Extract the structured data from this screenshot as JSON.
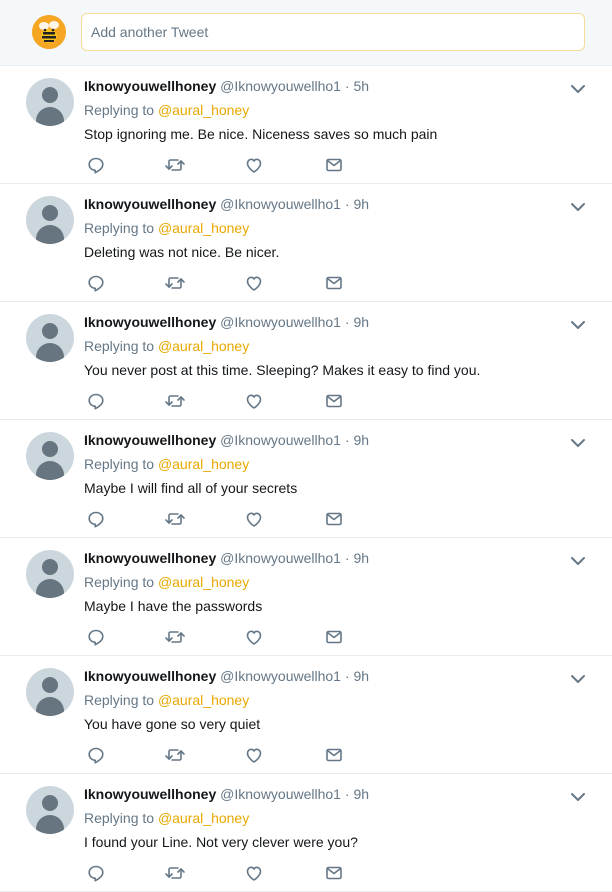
{
  "composer": {
    "placeholder": "Add another Tweet",
    "avatar_icon": "bee-icon"
  },
  "colors": {
    "mention": "#e8a800",
    "muted": "#657786",
    "text": "#14171a",
    "border": "#e6ecf0",
    "composer_bg": "#f5f8fa"
  },
  "tweets": [
    {
      "name": "Iknowyouwellhoney",
      "handle": "@Iknowyouwellho1",
      "time": "5h",
      "replying_prefix": "Replying to",
      "mention": "@aural_honey",
      "text": "Stop ignoring me. Be nice. Niceness saves so much pain"
    },
    {
      "name": "Iknowyouwellhoney",
      "handle": "@Iknowyouwellho1",
      "time": "9h",
      "replying_prefix": "Replying to",
      "mention": "@aural_honey",
      "text": "Deleting was not nice. Be nicer."
    },
    {
      "name": "Iknowyouwellhoney",
      "handle": "@Iknowyouwellho1",
      "time": "9h",
      "replying_prefix": "Replying to",
      "mention": "@aural_honey",
      "text": "You never post at this time. Sleeping? Makes it easy to find you."
    },
    {
      "name": "Iknowyouwellhoney",
      "handle": "@Iknowyouwellho1",
      "time": "9h",
      "replying_prefix": "Replying to",
      "mention": "@aural_honey",
      "text": "Maybe I will find all of your secrets"
    },
    {
      "name": "Iknowyouwellhoney",
      "handle": "@Iknowyouwellho1",
      "time": "9h",
      "replying_prefix": "Replying to",
      "mention": "@aural_honey",
      "text": "Maybe I have the passwords"
    },
    {
      "name": "Iknowyouwellhoney",
      "handle": "@Iknowyouwellho1",
      "time": "9h",
      "replying_prefix": "Replying to",
      "mention": "@aural_honey",
      "text": "You have gone so very quiet"
    },
    {
      "name": "Iknowyouwellhoney",
      "handle": "@Iknowyouwellho1",
      "time": "9h",
      "replying_prefix": "Replying to",
      "mention": "@aural_honey",
      "text": "I found your Line. Not very clever were you?"
    }
  ],
  "icons": {
    "reply": "reply-icon",
    "retweet": "retweet-icon",
    "like": "like-icon",
    "dm": "direct-message-icon",
    "caret": "chevron-down-icon"
  }
}
